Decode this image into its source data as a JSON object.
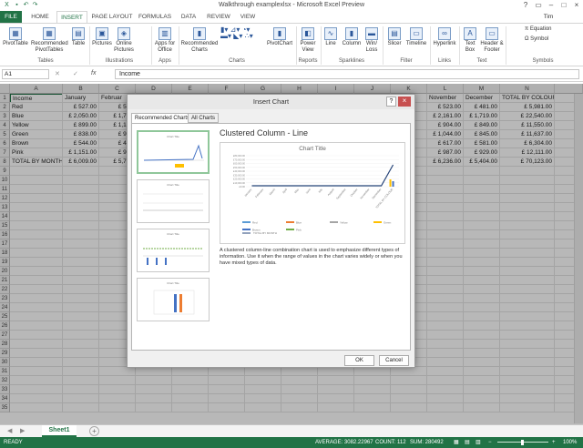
{
  "window": {
    "title": "Walkthrough examplexlsx - Microsoft Excel Preview",
    "user": "Tim"
  },
  "tabs": [
    "FILE",
    "HOME",
    "INSERT",
    "PAGE LAYOUT",
    "FORMULAS",
    "DATA",
    "REVIEW",
    "VIEW"
  ],
  "ribbon": {
    "buttons": [
      "PivotTable",
      "Recommended PivotTables",
      "Table",
      "Pictures",
      "Online Pictures",
      "Apps for Office",
      "Recommended Charts",
      "PivotChart",
      "Power View",
      "Line",
      "Column",
      "Win/ Loss",
      "Slicer",
      "Timeline",
      "Hyperlink",
      "Text Box",
      "Header & Footer",
      "Equation",
      "Symbol"
    ],
    "groups": [
      "Tables",
      "Illustrations",
      "Apps",
      "Charts",
      "Reports",
      "Sparklines",
      "Filter",
      "Links",
      "Text",
      "Symbols"
    ]
  },
  "formula_bar": {
    "name_box": "A1",
    "fx": "fx",
    "value": "Income"
  },
  "columns": [
    "A",
    "B",
    "C",
    "D",
    "E",
    "F",
    "G",
    "H",
    "I",
    "J",
    "K",
    "L",
    "M",
    "N"
  ],
  "header_row": {
    "a": "Income",
    "b": "January",
    "c": "Februar",
    "l": "November",
    "m": "December",
    "n": "TOTAL BY COLOUR"
  },
  "rows": [
    {
      "n": "2",
      "a": "Red",
      "b": "£ 527.00",
      "c": "£ 510",
      "l": "£ 523.00",
      "m": "£ 481.00",
      "total": "£ 5,981.00"
    },
    {
      "n": "3",
      "a": "Blue",
      "b": "£ 2,050.00",
      "c": "£ 1,712",
      "l": "£ 2,161.00",
      "m": "£ 1,719.00",
      "total": "£ 22,540.00"
    },
    {
      "n": "4",
      "a": "Yellow",
      "b": "£ 899.00",
      "c": "£ 1,100",
      "l": "£ 904.00",
      "m": "£ 849.00",
      "total": "£ 11,550.00"
    },
    {
      "n": "5",
      "a": "Green",
      "b": "£ 838.00",
      "c": "£ 980",
      "l": "£ 1,044.00",
      "m": "£ 845.00",
      "total": "£ 11,637.00"
    },
    {
      "n": "6",
      "a": "Brown",
      "b": "£ 544.00",
      "c": "£ 441",
      "l": "£ 617.00",
      "m": "£ 581.00",
      "total": "£ 6,304.00"
    },
    {
      "n": "7",
      "a": "Pink",
      "b": "£ 1,151.00",
      "c": "£ 996",
      "l": "£ 987.00",
      "m": "£ 929.00",
      "total": "£ 12,111.00"
    },
    {
      "n": "8",
      "a": "TOTAL BY MONTH",
      "b": "£ 6,009.00",
      "c": "£ 5,739",
      "l": "£ 6,236.00",
      "m": "£ 5,404.00",
      "total": "£ 70,123.00"
    }
  ],
  "empty_rows": [
    "9",
    "10",
    "11",
    "12",
    "13",
    "14",
    "15",
    "16",
    "17",
    "18",
    "19",
    "20",
    "21",
    "22",
    "23",
    "24",
    "25",
    "26",
    "27",
    "28",
    "29",
    "30",
    "31",
    "32",
    "33",
    "34",
    "35"
  ],
  "dialog": {
    "title": "Insert Chart",
    "tab_recommended": "Recommended Charts",
    "tab_all": "All Charts",
    "preview_heading": "Clustered Column - Line",
    "chart_title": "Chart Title",
    "y_ticks": [
      "£80,000.00",
      "£70,000.00",
      "£60,000.00",
      "£50,000.00",
      "£40,000.00",
      "£30,000.00",
      "£20,000.00",
      "£10,000.00",
      "£0.00"
    ],
    "months": [
      "January",
      "February",
      "March",
      "April",
      "May",
      "June",
      "July",
      "August",
      "September",
      "October",
      "November",
      "December",
      "TOTAL BY COLOUR"
    ],
    "legend": [
      "Red",
      "Blue",
      "Yellow",
      "Green",
      "Brown",
      "Pink",
      "TOTAL BY MONTH"
    ],
    "description": "A clustered column-line combination chart is used to emphasize different types of information. Use it when the range of values in the chart varies widely or when you have mixed types of data.",
    "ok": "OK",
    "cancel": "Cancel",
    "thumb_title": "Chart Title"
  },
  "sheet_tab": "Sheet1",
  "status": {
    "ready": "READY",
    "average": "AVERAGE: 3082.22967",
    "count": "COUNT: 112",
    "sum": "SUM: 280492",
    "zoom": "100%"
  },
  "colors": {
    "excel_green": "#217346",
    "series": [
      "#5b9bd5",
      "#ed7d31",
      "#a5a5a5",
      "#ffc000",
      "#4472c4",
      "#70ad47",
      "#264478"
    ]
  }
}
